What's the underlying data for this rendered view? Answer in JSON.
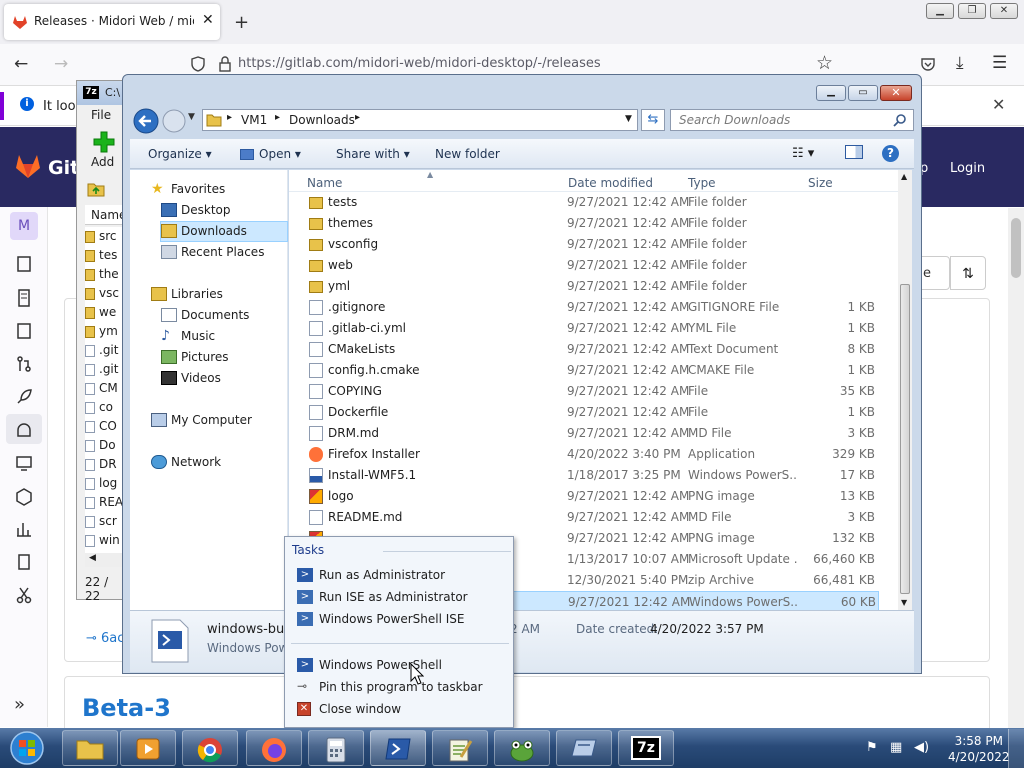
{
  "browser": {
    "tab_title": "Releases · Midori Web / midori-",
    "url": "https://gitlab.com/midori-web/midori-desktop/-/releases",
    "notification_text": "It look",
    "new_tab_symbol": "+"
  },
  "gitlab": {
    "logo_text": "Gitl",
    "header_links": [
      "p",
      "Login"
    ],
    "avatar_letter": "M",
    "breadcrumb_start": "M",
    "sort_partial": "e",
    "commit_partial": "6ac",
    "section_title": "Beta-3"
  },
  "sevenzip": {
    "title_partial": "C:\\",
    "menu_file": "File",
    "add_label": "Add",
    "column_name": "Name",
    "items": [
      "src",
      "tes",
      "the",
      "vsc",
      "we",
      "ym",
      ".git",
      ".git",
      "CM",
      "co",
      "CO",
      "Do",
      "DR",
      "log",
      "REA",
      "scr",
      "win"
    ],
    "status": "22 / 22"
  },
  "explorer": {
    "breadcrumb": [
      "VM1",
      "Downloads"
    ],
    "search_placeholder": "Search Downloads",
    "toolbar": {
      "organize": "Organize",
      "open": "Open",
      "share_with": "Share with",
      "new_folder": "New folder"
    },
    "nav": {
      "favorites": "Favorites",
      "desktop": "Desktop",
      "downloads": "Downloads",
      "recent": "Recent Places",
      "libraries": "Libraries",
      "documents": "Documents",
      "music": "Music",
      "pictures": "Pictures",
      "videos": "Videos",
      "my_computer": "My Computer",
      "network": "Network"
    },
    "columns": {
      "name": "Name",
      "date": "Date modified",
      "type": "Type",
      "size": "Size"
    },
    "files": [
      {
        "name": "tests",
        "date": "9/27/2021 12:42 AM",
        "type": "File folder",
        "size": "",
        "icon": "folder-icon"
      },
      {
        "name": "themes",
        "date": "9/27/2021 12:42 AM",
        "type": "File folder",
        "size": "",
        "icon": "folder-icon"
      },
      {
        "name": "vsconfig",
        "date": "9/27/2021 12:42 AM",
        "type": "File folder",
        "size": "",
        "icon": "folder-icon"
      },
      {
        "name": "web",
        "date": "9/27/2021 12:42 AM",
        "type": "File folder",
        "size": "",
        "icon": "folder-icon"
      },
      {
        "name": "yml",
        "date": "9/27/2021 12:42 AM",
        "type": "File folder",
        "size": "",
        "icon": "folder-icon"
      },
      {
        "name": ".gitignore",
        "date": "9/27/2021 12:42 AM",
        "type": "GITIGNORE File",
        "size": "1 KB",
        "icon": "file-icon"
      },
      {
        "name": ".gitlab-ci.yml",
        "date": "9/27/2021 12:42 AM",
        "type": "YML File",
        "size": "1 KB",
        "icon": "file-icon"
      },
      {
        "name": "CMakeLists",
        "date": "9/27/2021 12:42 AM",
        "type": "Text Document",
        "size": "8 KB",
        "icon": "file-icon"
      },
      {
        "name": "config.h.cmake",
        "date": "9/27/2021 12:42 AM",
        "type": "CMAKE File",
        "size": "1 KB",
        "icon": "file-icon"
      },
      {
        "name": "COPYING",
        "date": "9/27/2021 12:42 AM",
        "type": "File",
        "size": "35 KB",
        "icon": "file-icon"
      },
      {
        "name": "Dockerfile",
        "date": "9/27/2021 12:42 AM",
        "type": "File",
        "size": "1 KB",
        "icon": "file-icon"
      },
      {
        "name": "DRM.md",
        "date": "9/27/2021 12:42 AM",
        "type": "MD File",
        "size": "3 KB",
        "icon": "file-icon"
      },
      {
        "name": "Firefox Installer",
        "date": "4/20/2022 3:40 PM",
        "type": "Application",
        "size": "329 KB",
        "icon": "firefox-icon"
      },
      {
        "name": "Install-WMF5.1",
        "date": "1/18/2017 3:25 PM",
        "type": "Windows PowerS...",
        "size": "17 KB",
        "icon": "powershell-script-icon"
      },
      {
        "name": "logo",
        "date": "9/27/2021 12:42 AM",
        "type": "PNG image",
        "size": "13 KB",
        "icon": "image-icon"
      },
      {
        "name": "README.md",
        "date": "9/27/2021 12:42 AM",
        "type": "MD File",
        "size": "3 KB",
        "icon": "file-icon"
      },
      {
        "name": "",
        "date": "9/27/2021 12:42 AM",
        "type": "PNG image",
        "size": "132 KB",
        "icon": "image-icon"
      },
      {
        "name": "",
        "date": "1/13/2017 10:07 AM",
        "type": "Microsoft Update ...",
        "size": "66,460 KB",
        "icon": "file-icon"
      },
      {
        "name": "",
        "date": "12/30/2021 5:40 PM",
        "type": "zip Archive",
        "size": "66,481 KB",
        "icon": "file-icon"
      },
      {
        "name": "",
        "date": "9/27/2021 12:42 AM",
        "type": "Windows PowerS...",
        "size": "60 KB",
        "icon": "powershell-script-icon"
      }
    ],
    "details": {
      "name": "windows-buil",
      "type": "Windows Pow",
      "modified": "2 AM",
      "created_label": "Date created:",
      "created_value": "4/20/2022 3:57 PM"
    }
  },
  "context_menu": {
    "header": "Tasks",
    "items": [
      "Run as Administrator",
      "Run ISE as Administrator",
      "Windows PowerShell ISE",
      "Windows PowerShell",
      "Pin this program to taskbar",
      "Close window"
    ]
  },
  "taskbar": {
    "time": "3:58 PM",
    "date": "4/20/2022"
  },
  "colors": {
    "gitlab_header": "#292961",
    "selection": "#cce8ff",
    "link": "#1f75cb"
  }
}
